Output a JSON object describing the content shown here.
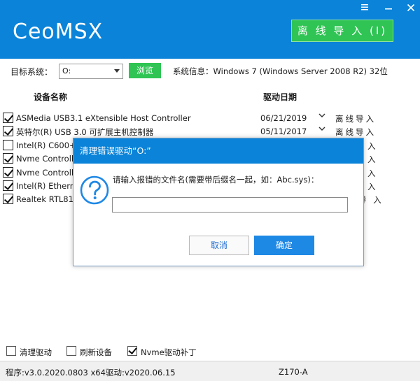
{
  "app": {
    "logo": "CeoMSX",
    "menu_icon": "menu-icon",
    "min_icon": "minimize-icon",
    "close_icon": "close-icon",
    "offline_import_label": "离 线 导 入 (I)"
  },
  "toolbar": {
    "target_label": "目标系统：",
    "drive_value": "O:",
    "browse_label": "浏览",
    "sysinfo_text": "系统信息：Windows 7 (Windows Server 2008 R2)    32位"
  },
  "columns": {
    "name": "设备名称",
    "date": "驱动日期"
  },
  "drivers": [
    {
      "checked": true,
      "name": "ASMedia USB3.1 eXtensible Host Controller",
      "date": "06/21/2019",
      "action": "离线导入"
    },
    {
      "checked": true,
      "name": "英特尔(R) USB 3.0 可扩展主机控制器",
      "date": "05/11/2017",
      "action": "离线导入"
    },
    {
      "checked": false,
      "name": "Intel(R) C600+/",
      "date": "",
      "action": "入"
    },
    {
      "checked": true,
      "name": "Nvme Controlle",
      "date": "",
      "action": "入"
    },
    {
      "checked": true,
      "name": "Nvme Controlle",
      "date": "",
      "action": "入"
    },
    {
      "checked": true,
      "name": "Intel(R) Etherne",
      "date": "",
      "action": "入"
    },
    {
      "checked": true,
      "name": "Realtek RTL818",
      "date": "",
      "action": "导 入"
    }
  ],
  "dialog": {
    "title": "清理错误驱动“O:”",
    "icon": "question-icon",
    "message": "请输入报错的文件名(需要带后缀名一起，如：Abc.sys)：",
    "input_value": "",
    "cancel_label": "取消",
    "ok_label": "确定"
  },
  "options": {
    "clean_label": "清理驱动",
    "clean_checked": false,
    "refresh_label": "刷新设备",
    "refresh_checked": false,
    "nvme_label": "Nvme驱动补丁",
    "nvme_checked": true
  },
  "status": {
    "program": "程序:v3.0.2020.0803 x64",
    "driver": "驱动:v2020.06.15",
    "board": "Z170-A"
  },
  "colors": {
    "header_blue": "#0a83d8",
    "green_button": "#2fc454",
    "ok_blue": "#1e88e5"
  }
}
